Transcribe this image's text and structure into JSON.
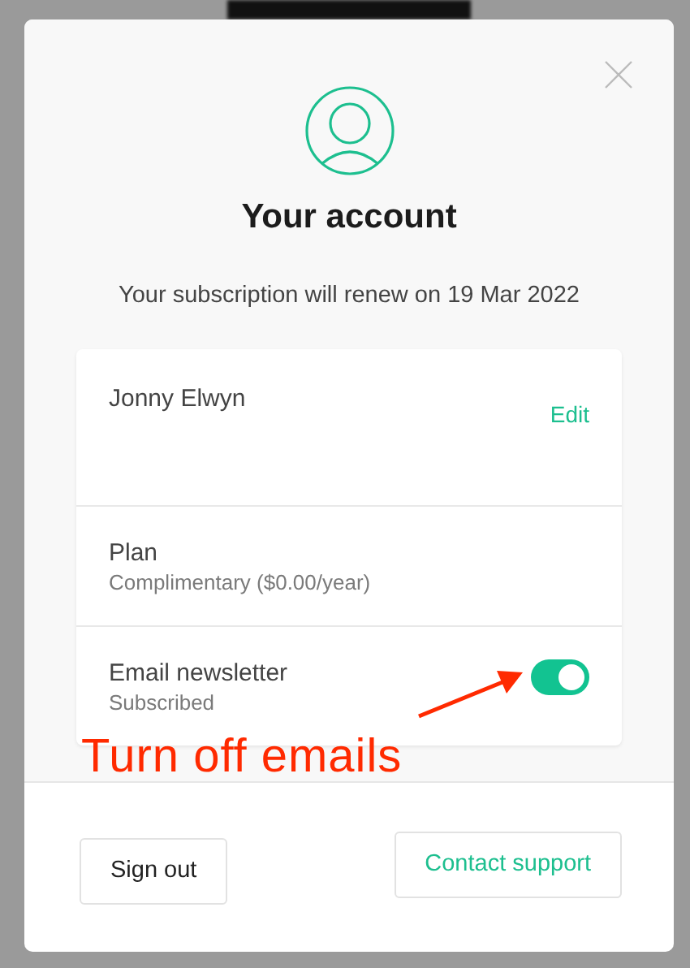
{
  "modal": {
    "title": "Your account",
    "subtitle": "Your subscription will renew on 19 Mar 2022"
  },
  "rows": [
    {
      "kind": "edit",
      "label": "Jonny Elwyn",
      "action": "Edit"
    },
    {
      "kind": "info",
      "label": "Plan",
      "detail": "Complimentary ($0.00/year)"
    },
    {
      "kind": "toggle",
      "label": "Email newsletter",
      "detail": "Subscribed",
      "on": true
    }
  ],
  "annotation": {
    "text": "Turn off emails"
  },
  "buttons": [
    {
      "label": "Sign out",
      "kind": "secondary"
    },
    {
      "label": "Contact support",
      "kind": "primary"
    }
  ]
}
